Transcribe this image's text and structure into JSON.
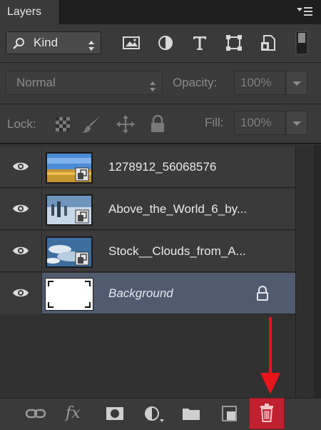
{
  "panel": {
    "tab_label": "Layers"
  },
  "filter": {
    "kind_label": "Kind",
    "icons": [
      "image-filter-icon",
      "adjustment-filter-icon",
      "type-filter-icon",
      "shape-filter-icon",
      "smart-object-filter-icon",
      "filter-toggle-icon"
    ]
  },
  "blend": {
    "mode": "Normal",
    "opacity_label": "Opacity:",
    "opacity_value": "100%"
  },
  "lock": {
    "label": "Lock:",
    "fill_label": "Fill:",
    "fill_value": "100%",
    "icons": [
      "lock-transparent-pixels-icon",
      "lock-image-pixels-icon",
      "lock-position-icon",
      "lock-all-icon"
    ]
  },
  "layers": [
    {
      "name": "1278912_56068576",
      "visible": true,
      "type": "smart-object"
    },
    {
      "name": "Above_the_World_6_by...",
      "visible": true,
      "type": "smart-object"
    },
    {
      "name": "Stock__Clouds_from_A...",
      "visible": true,
      "type": "smart-object"
    },
    {
      "name": "Background",
      "visible": true,
      "type": "background",
      "locked": true,
      "selected": true
    }
  ],
  "footer": {
    "tools": [
      "link-layers-icon",
      "fx-icon",
      "add-mask-icon",
      "adjustment-layer-icon",
      "new-group-icon",
      "new-layer-icon",
      "delete-layer-icon"
    ],
    "fx_label": "fx",
    "highlight_color": "#c0212e"
  },
  "annotation": {
    "arrow_color": "#e8141c"
  }
}
